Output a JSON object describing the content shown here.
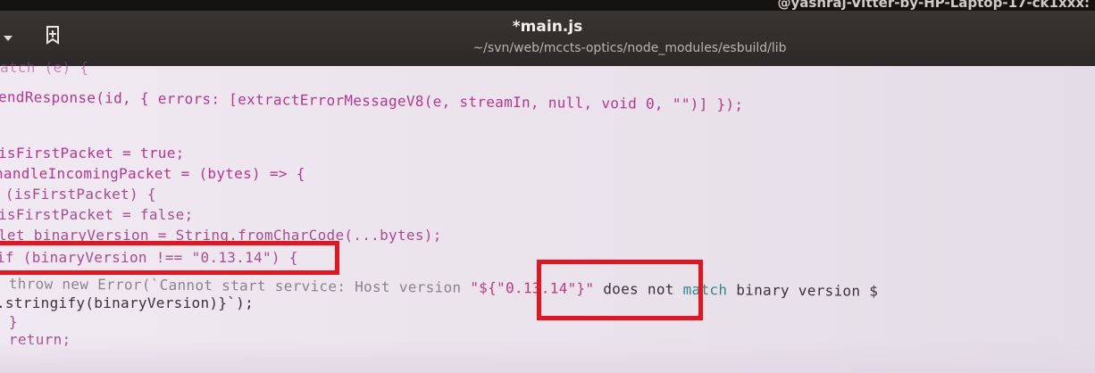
{
  "system": {
    "top_text": "@yashraj-Vitter-by-HP-Laptop-17-ck1xxx:"
  },
  "window": {
    "title": "*main.js",
    "path": "~/svn/web/mccts-optics/node_modules/esbuild/lib"
  },
  "icons": {
    "bookmark": "bookmark-add-icon",
    "menu": "chevron-down-icon"
  },
  "code": {
    "l1": "atch (e) {",
    "l2": "endResponse(id, { errors: [extractErrorMessageV8(e, streamIn, null, void 0, \"\")] });",
    "l3": "isFirstPacket = true;",
    "l4": "handleIncomingPacket = (bytes) => {",
    "l5": " (isFirstPacket) {",
    "l6": "isFirstPacket = false;",
    "l7": "let binaryVersion = String.fromCharCode(...bytes);",
    "l8": "if (binaryVersion !== \"0.13.14\") {",
    "l9a": "   throw new Error(`Cannot start service: Host version ",
    "l9b": "\"${\"0.13.14\"}\"",
    "l9c": " does not ",
    "l9d": "match",
    "l9e": " binary version $",
    "l10": ".stringify(binaryVersion)}`);",
    "l11": " }",
    "l12": " return;"
  },
  "colors": {
    "highlight_box": "#e8141d"
  }
}
